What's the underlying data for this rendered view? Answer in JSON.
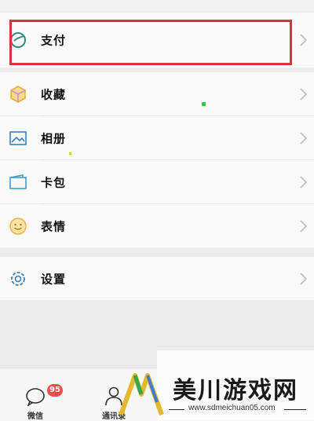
{
  "menu": {
    "items": [
      {
        "label": "支付",
        "icon": "payment-icon"
      },
      {
        "label": "收藏",
        "icon": "favorites-icon"
      },
      {
        "label": "相册",
        "icon": "album-icon"
      },
      {
        "label": "卡包",
        "icon": "card-wallet-icon"
      },
      {
        "label": "表情",
        "icon": "sticker-icon"
      },
      {
        "label": "设置",
        "icon": "settings-icon"
      }
    ]
  },
  "tabbar": {
    "tabs": [
      {
        "label": "微信",
        "badge": "95",
        "icon": "chat-icon"
      },
      {
        "label": "通讯录",
        "icon": "contacts-icon"
      }
    ]
  },
  "watermark": {
    "text": "美川游戏网",
    "url": "www.sdmeichuan05.com"
  },
  "colors": {
    "highlight": "#d8343d",
    "badge": "#f04a4a",
    "accent_green": "#2ecc40"
  }
}
